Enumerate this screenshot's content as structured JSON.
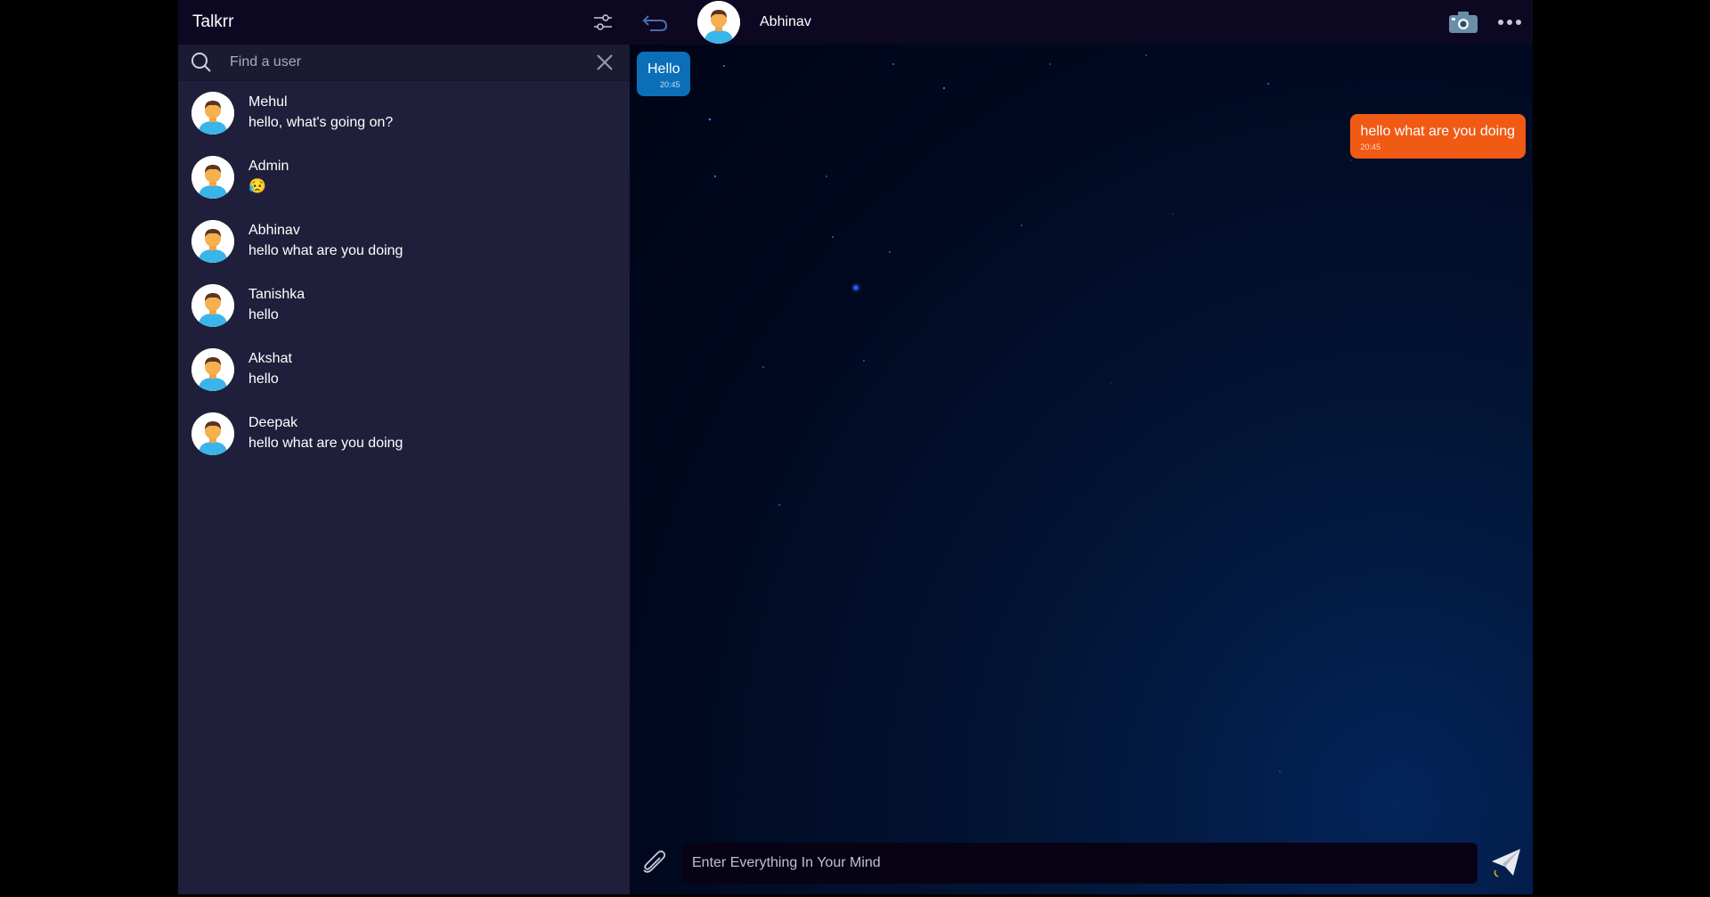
{
  "app": {
    "title": "Talkrr"
  },
  "search": {
    "placeholder": "Find a user",
    "value": ""
  },
  "contacts": [
    {
      "name": "Mehul",
      "last_message": "hello, what's going on?"
    },
    {
      "name": "Admin",
      "last_message": "😥"
    },
    {
      "name": "Abhinav",
      "last_message": "hello what are you doing"
    },
    {
      "name": "Tanishka",
      "last_message": "hello"
    },
    {
      "name": "Akshat",
      "last_message": "hello"
    },
    {
      "name": "Deepak",
      "last_message": "hello what are you doing"
    }
  ],
  "chat": {
    "contact_name": "Abhinav",
    "messages": [
      {
        "direction": "incoming",
        "text": "Hello",
        "time": "20:45"
      },
      {
        "direction": "outgoing",
        "text": "hello what are you doing",
        "time": "20:45"
      }
    ]
  },
  "composer": {
    "placeholder": "Enter Everything In Your Mind",
    "value": ""
  },
  "colors": {
    "incoming_bubble": "#0b6fb8",
    "outgoing_bubble": "#f05a14",
    "sidebar_bg": "#1f1f3b",
    "header_bg": "#0d0822"
  },
  "icons": [
    "filter-settings-icon",
    "search-icon",
    "close-icon",
    "back-arrow-icon",
    "camera-icon",
    "more-icon",
    "paperclip-icon",
    "send-icon"
  ]
}
